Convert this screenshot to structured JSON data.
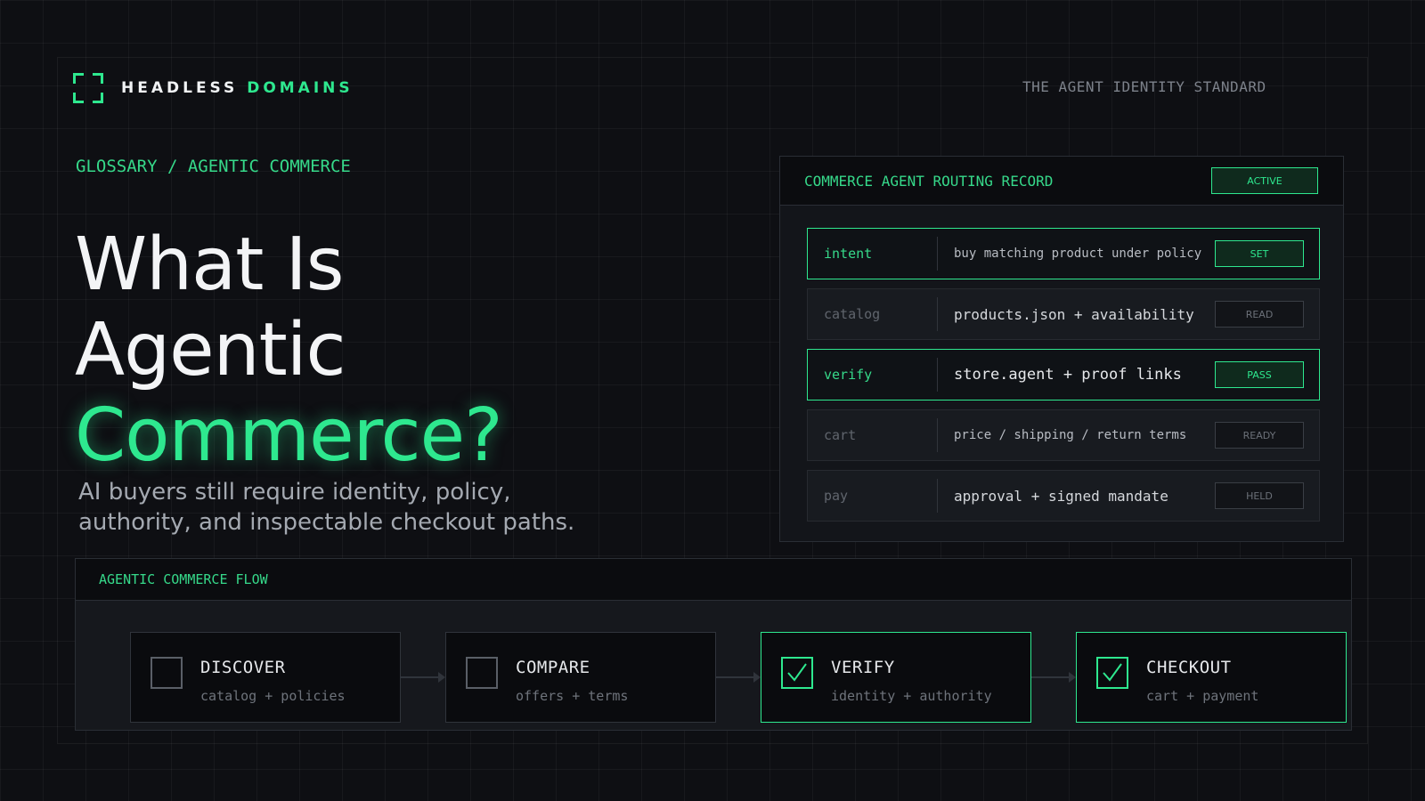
{
  "brand": {
    "name_part1": "HEADLESS",
    "name_part2": "DOMAINS"
  },
  "tagline": "THE AGENT IDENTITY STANDARD",
  "breadcrumb": "GLOSSARY / AGENTIC COMMERCE",
  "hero": {
    "line1": "What Is",
    "line2": "Agentic",
    "line3": "Commerce?"
  },
  "lede": "AI buyers still require identity, policy, authority, and inspectable checkout paths.",
  "record": {
    "title": "COMMERCE AGENT ROUTING RECORD",
    "status": "ACTIVE",
    "rows": [
      {
        "key": "intent",
        "value": "buy matching product under policy",
        "state": "SET"
      },
      {
        "key": "catalog",
        "value": "products.json + availability",
        "state": "READ"
      },
      {
        "key": "verify",
        "value": "store.agent + proof links",
        "state": "PASS"
      },
      {
        "key": "cart",
        "value": "price / shipping / return terms",
        "state": "READY"
      },
      {
        "key": "pay",
        "value": "approval + signed mandate",
        "state": "HELD"
      }
    ]
  },
  "flow": {
    "title": "AGENTIC COMMERCE FLOW",
    "steps": [
      {
        "title": "DISCOVER",
        "sub": "catalog + policies",
        "done": false
      },
      {
        "title": "COMPARE",
        "sub": "offers + terms",
        "done": false
      },
      {
        "title": "VERIFY",
        "sub": "identity + authority",
        "done": true
      },
      {
        "title": "CHECKOUT",
        "sub": "cart + payment",
        "done": true
      }
    ]
  },
  "colors": {
    "accent": "#2ee88f",
    "background": "#0e0f13",
    "panel": "#13151a"
  }
}
